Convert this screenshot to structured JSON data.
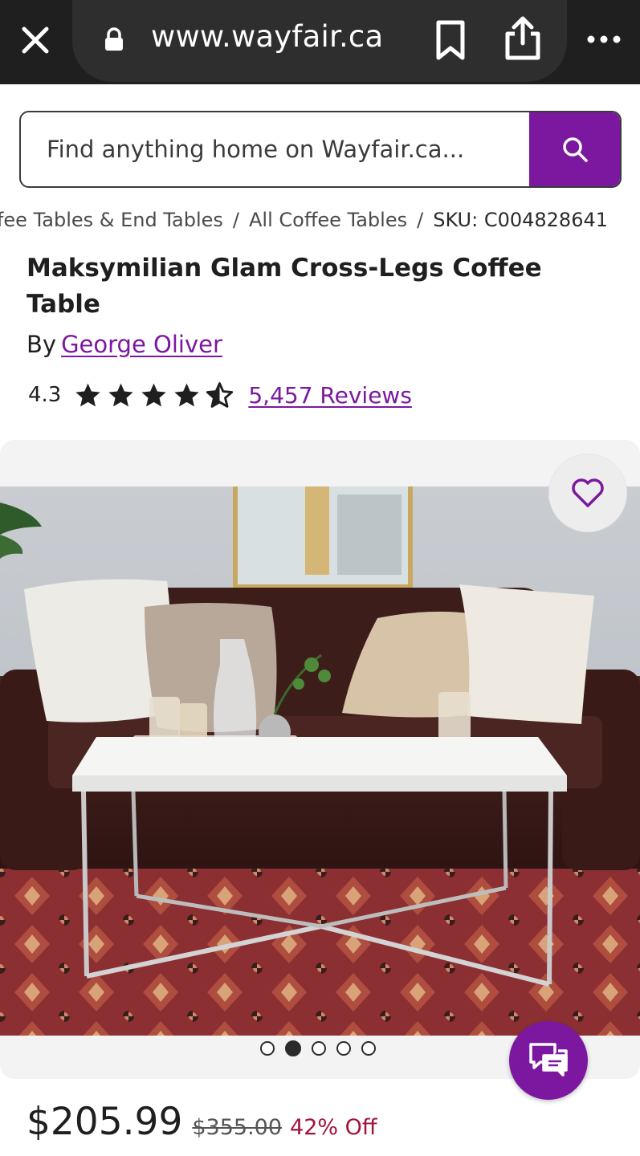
{
  "browser": {
    "url": "www.wayfair.ca",
    "icons": [
      "close-icon",
      "lock-icon",
      "bookmark-icon",
      "share-icon",
      "more-icon"
    ]
  },
  "search": {
    "placeholder": "Find anything home on Wayfair.ca...",
    "button_icon": "search-icon"
  },
  "breadcrumb": {
    "items": [
      "Coffee Tables & End Tables",
      "All Coffee Tables"
    ],
    "sku": "SKU: C004828641",
    "separator": "/"
  },
  "product": {
    "title": "Maksymilian Glam Cross-Legs Coffee Table",
    "by_label": "By",
    "brand": "George Oliver",
    "rating": "4.3",
    "rating_fraction": 0.86,
    "reviews": "5,457 Reviews"
  },
  "gallery": {
    "slide_count": 5,
    "active_slide": 2,
    "favorite_icon": "heart-icon"
  },
  "price": {
    "current": "$205.99",
    "was": "$355.00",
    "discount": "42% Off"
  },
  "chat": {
    "icon": "chat-icon"
  },
  "colors": {
    "brand_purple": "#7b189f",
    "discount_red": "#a3123a",
    "top_bar": "#1f1f1f"
  }
}
